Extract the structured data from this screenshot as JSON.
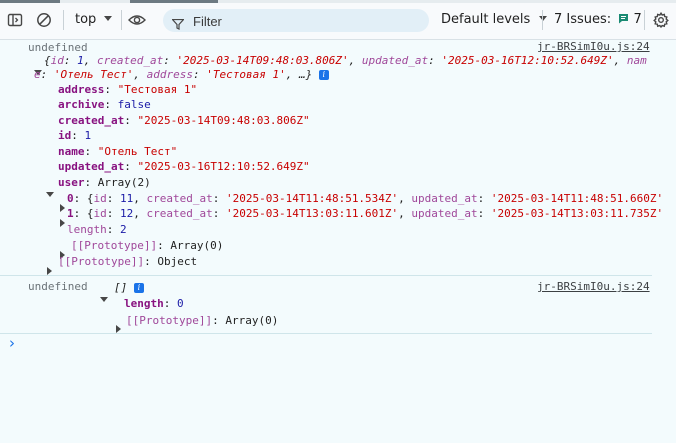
{
  "toolbar": {
    "context": "top",
    "filter_placeholder": "Filter",
    "levels_label": "Default levels",
    "issues_label": "7 Issues:",
    "issues_count": "7"
  },
  "messages": [
    {
      "prefix": "undefined",
      "source": "jr-BRSimI0u.js:24",
      "summary": {
        "line1_open": "{",
        "k_id": "id",
        "v_id": "1",
        "k_created": "created_at",
        "v_created": "'2025-03-14T09:48:03.806Z'",
        "k_updated": "updated_at",
        "v_updated": "'2025-03-16T12:10:52.649Z'",
        "k_name_part1": "nam",
        "k_name_part2": "e",
        "v_name": "'Отель Тест'",
        "k_address": "address",
        "v_address": "'Тестовая 1'",
        "tail": "…}"
      },
      "props": [
        {
          "key": "address",
          "value": "\"Тестовая 1\"",
          "type": "str"
        },
        {
          "key": "archive",
          "value": "false",
          "type": "kw"
        },
        {
          "key": "created_at",
          "value": "\"2025-03-14T09:48:03.806Z\"",
          "type": "str"
        },
        {
          "key": "id",
          "value": "1",
          "type": "num"
        },
        {
          "key": "name",
          "value": "\"Отель Тест\"",
          "type": "str"
        },
        {
          "key": "updated_at",
          "value": "\"2025-03-16T12:10:52.649Z\"",
          "type": "str"
        }
      ],
      "user": {
        "key": "user",
        "value": "Array(2)",
        "items": [
          {
            "index": "0",
            "id": "11",
            "created_at": "'2025-03-14T11:48:51.534Z'",
            "updated_at": "'2025-03-14T11:48:51.660Z'"
          },
          {
            "index": "1",
            "id": "12",
            "created_at": "'2025-03-14T13:03:11.601Z'",
            "updated_at": "'2025-03-14T13:03:11.735Z'"
          }
        ],
        "length_key": "length",
        "length_value": "2",
        "proto_key": "[[Prototype]]",
        "proto_value": "Array(0)"
      },
      "proto_key": "[[Prototype]]",
      "proto_value": "Object"
    },
    {
      "prefix": "undefined",
      "source": "jr-BRSimI0u.js:24",
      "summary": "[]",
      "length_key": "length",
      "length_value": "0",
      "proto_key": "[[Prototype]]",
      "proto_value": "Array(0)"
    }
  ],
  "prompt_symbol": "›",
  "labels": {
    "id": "id",
    "created_at": "created_at",
    "updated_at": "updated_at",
    "colon": ":"
  }
}
